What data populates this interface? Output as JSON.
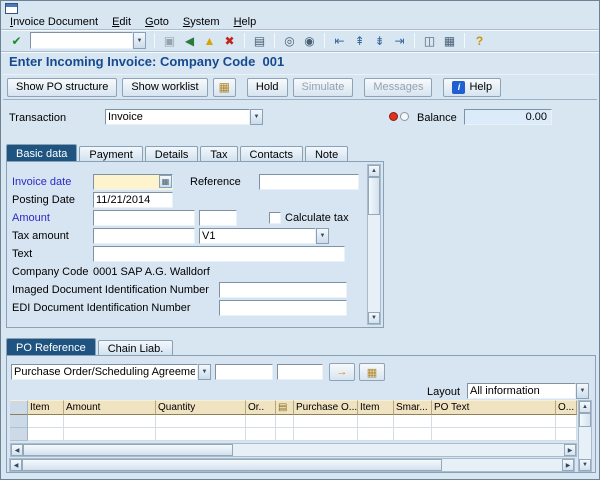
{
  "colors": {
    "title_blue": "#16498f",
    "active_tab_blue": "#1f5480",
    "required_field_yellow": "#fdf3cd",
    "table_header_beige": "#efe3c1",
    "status_light_red": "#e0301e"
  },
  "menu_bar": {
    "items": [
      {
        "label": "Invoice Document"
      },
      {
        "label": "Edit"
      },
      {
        "label": "Goto"
      },
      {
        "label": "System"
      },
      {
        "label": "Help"
      }
    ]
  },
  "toolbar": {
    "enter_glyph": "✔",
    "command_value": "",
    "icons": [
      {
        "name": "save-icon",
        "glyph": "▣"
      },
      {
        "name": "back-icon",
        "glyph": "◀"
      },
      {
        "name": "exit-icon",
        "glyph": "▲"
      },
      {
        "name": "cancel-icon",
        "glyph": "✖"
      },
      {
        "name": "print-icon",
        "glyph": "▤"
      },
      {
        "name": "find-icon",
        "glyph": "◎"
      },
      {
        "name": "find-next-icon",
        "glyph": "◉"
      },
      {
        "name": "first-page-icon",
        "glyph": "⇤"
      },
      {
        "name": "page-up-icon",
        "glyph": "⇞"
      },
      {
        "name": "page-down-icon",
        "glyph": "⇟"
      },
      {
        "name": "last-page-icon",
        "glyph": "⇥"
      },
      {
        "name": "new-session-icon",
        "glyph": "◫"
      },
      {
        "name": "shortcut-icon",
        "glyph": "▦"
      },
      {
        "name": "help-icon",
        "glyph": "?"
      }
    ]
  },
  "title": "Enter Incoming Invoice: Company Code  001",
  "app_toolbar": {
    "show_po_structure": "Show PO structure",
    "show_worklist": "Show worklist",
    "tree_icon_glyph": "▦",
    "hold": "Hold",
    "simulate": "Simulate",
    "messages": "Messages",
    "help": "Help",
    "info_glyph": "i"
  },
  "transaction": {
    "label": "Transaction",
    "value": "Invoice",
    "balance_label": "Balance",
    "balance_value": "0.00"
  },
  "tabs": {
    "items": [
      {
        "label": "Basic data"
      },
      {
        "label": "Payment"
      },
      {
        "label": "Details"
      },
      {
        "label": "Tax"
      },
      {
        "label": "Contacts"
      },
      {
        "label": "Note"
      }
    ]
  },
  "form": {
    "invoice_date_label": "Invoice date",
    "invoice_date_value": "",
    "reference_label": "Reference",
    "reference_value": "",
    "posting_date_label": "Posting Date",
    "posting_date_value": "11/21/2014",
    "amount_label": "Amount",
    "amount_value": "",
    "currency_value": "",
    "calculate_tax_label": "Calculate tax",
    "tax_amount_label": "Tax amount",
    "tax_amount_value": "",
    "tax_code_value": "V1",
    "text_label": "Text",
    "text_value": "",
    "company_code_label": "Company Code",
    "company_code_value": "0001 SAP A.G. Walldorf",
    "imaged_doc_label": "Imaged Document Identification Number",
    "imaged_doc_value": "",
    "edi_doc_label": "EDI Document Identification Number",
    "edi_doc_value": ""
  },
  "po_tabs": {
    "items": [
      {
        "label": "PO Reference"
      },
      {
        "label": "Chain Liab."
      }
    ]
  },
  "po_section": {
    "po_type_value": "Purchase Order/Scheduling Agreement",
    "po_number_value": "",
    "po_item_value": "",
    "adopt_arrow_glyph": "→",
    "items_icon_glyph": "▦",
    "layout_label": "Layout",
    "layout_value": "All information"
  },
  "table": {
    "columns": [
      {
        "label": "Item"
      },
      {
        "label": "Amount"
      },
      {
        "label": "Quantity"
      },
      {
        "label": "Or.."
      },
      {
        "label": "▤"
      },
      {
        "label": "Purchase O..."
      },
      {
        "label": "Item"
      },
      {
        "label": "Smar..."
      },
      {
        "label": "PO Text"
      },
      {
        "label": "O..."
      }
    ]
  },
  "glyphs": {
    "up": "▲",
    "down": "▼",
    "left": "◀",
    "right": "▶",
    "dropdown": "▼",
    "calendar": "▦"
  }
}
